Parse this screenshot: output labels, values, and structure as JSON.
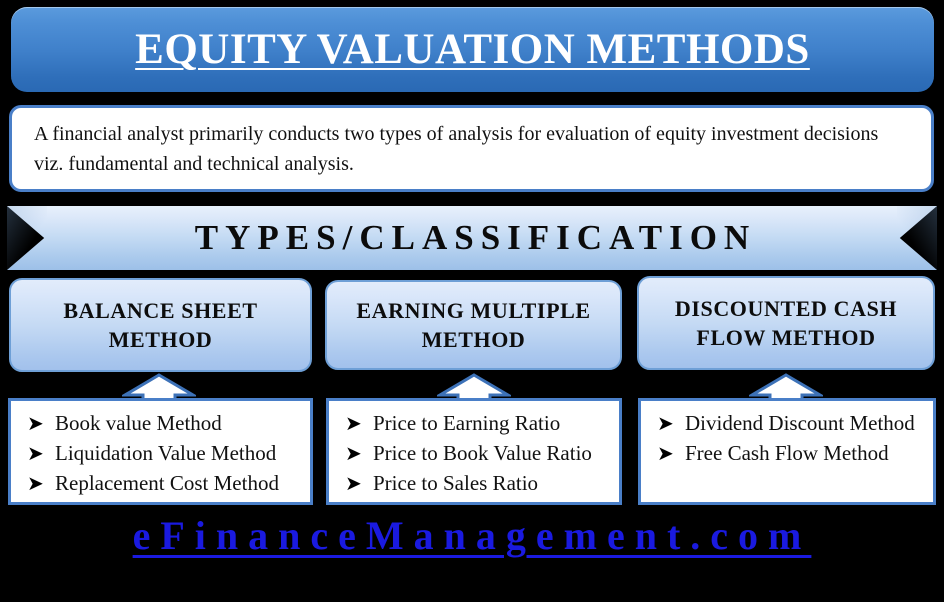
{
  "header": {
    "title": "EQUITY VALUATION METHODS"
  },
  "description": {
    "text": "A financial analyst primarily conducts two types of analysis for evaluation of equity investment decisions viz. fundamental and technical analysis."
  },
  "banner": {
    "label": "TYPES/CLASSIFICATION"
  },
  "methods": [
    {
      "title": "BALANCE SHEET METHOD",
      "items": [
        "Book value Method",
        "Liquidation Value Method",
        "Replacement Cost Method"
      ]
    },
    {
      "title": "EARNING MULTIPLE METHOD",
      "items": [
        "Price to Earning Ratio",
        "Price to Book Value Ratio",
        "Price to Sales Ratio"
      ]
    },
    {
      "title": "DISCOUNTED CASH FLOW METHOD",
      "items": [
        "Dividend Discount Method",
        "Free Cash Flow Method"
      ]
    }
  ],
  "bullet_glyph": "➤",
  "footer": {
    "brand": "eFinanceManagement.com"
  },
  "colors": {
    "background": "#000000",
    "header_blue_top": "#5b9bdd",
    "header_blue_bottom": "#2a69b4",
    "border_blue": "#4a7fc8",
    "box_blue_top": "#e2ecfb",
    "box_blue_bottom": "#a2c1ec",
    "brand_blue": "#1a1ae0"
  }
}
